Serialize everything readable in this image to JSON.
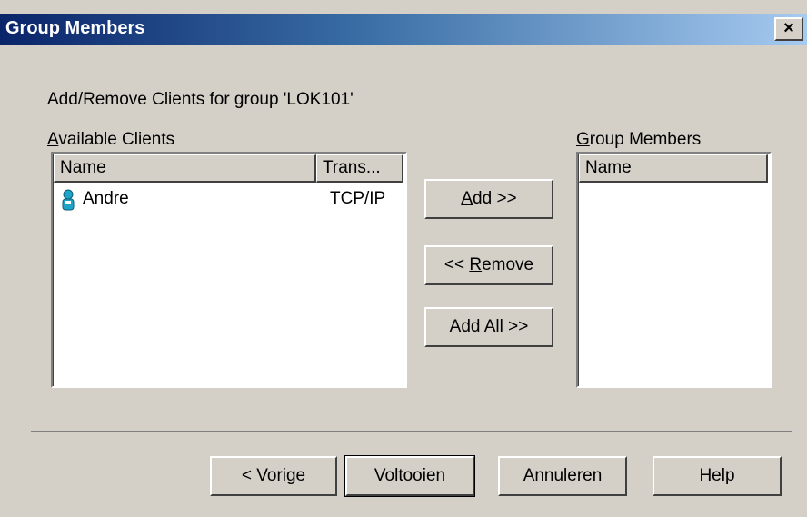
{
  "window": {
    "title": "Group Members",
    "close_label": "×"
  },
  "description": "Add/Remove Clients for group 'LOK101'",
  "available": {
    "label_u": "A",
    "label_rest": "vailable Clients",
    "columns": [
      "Name",
      "Trans..."
    ],
    "rows": [
      {
        "icon": "client-person-icon",
        "name": "Andre",
        "transport": "TCP/IP"
      }
    ]
  },
  "members": {
    "label_u": "G",
    "label_rest": "roup Members",
    "columns": [
      "Name"
    ],
    "rows": []
  },
  "buttons": {
    "add": {
      "u": "A",
      "rest": "dd >>"
    },
    "remove": {
      "pre": "<< ",
      "u": "R",
      "rest": "emove"
    },
    "add_all": {
      "pre": "Add A",
      "u": "l",
      "rest": "l >>"
    }
  },
  "footer": {
    "back": {
      "pre": "< ",
      "u": "V",
      "rest": "orige"
    },
    "finish": "Voltooien",
    "cancel": "Annuleren",
    "help": "Help"
  },
  "colors": {
    "face": "#d4d0c8",
    "title_start": "#0a246a",
    "title_end": "#a6caf0",
    "client_icon": "#1fa3c8"
  }
}
